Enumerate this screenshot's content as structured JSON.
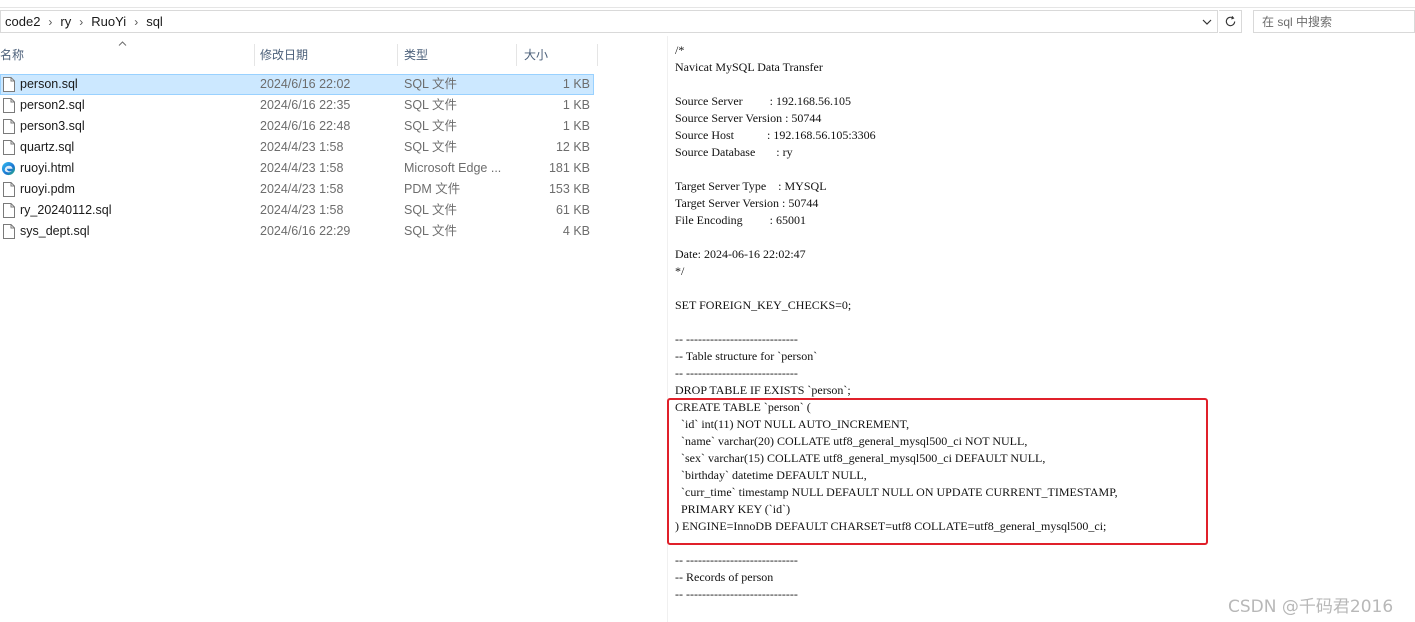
{
  "address_bar": {
    "crumbs": [
      "code2",
      "ry",
      "RuoYi",
      "sql"
    ],
    "search_placeholder": "在 sql 中搜索"
  },
  "columns": {
    "name": "名称",
    "date": "修改日期",
    "type": "类型",
    "size": "大小"
  },
  "files": [
    {
      "name": "person.sql",
      "date": "2024/6/16 22:02",
      "type": "SQL 文件",
      "size": "1 KB",
      "icon": "document-icon",
      "selected": true
    },
    {
      "name": "person2.sql",
      "date": "2024/6/16 22:35",
      "type": "SQL 文件",
      "size": "1 KB",
      "icon": "document-icon"
    },
    {
      "name": "person3.sql",
      "date": "2024/6/16 22:48",
      "type": "SQL 文件",
      "size": "1 KB",
      "icon": "document-icon"
    },
    {
      "name": "quartz.sql",
      "date": "2024/4/23 1:58",
      "type": "SQL 文件",
      "size": "12 KB",
      "icon": "document-icon"
    },
    {
      "name": "ruoyi.html",
      "date": "2024/4/23 1:58",
      "type": "Microsoft Edge ...",
      "size": "181 KB",
      "icon": "edge-icon"
    },
    {
      "name": "ruoyi.pdm",
      "date": "2024/4/23 1:58",
      "type": "PDM 文件",
      "size": "153 KB",
      "icon": "document-icon"
    },
    {
      "name": "ry_20240112.sql",
      "date": "2024/4/23 1:58",
      "type": "SQL 文件",
      "size": "61 KB",
      "icon": "document-icon"
    },
    {
      "name": "sys_dept.sql",
      "date": "2024/6/16 22:29",
      "type": "SQL 文件",
      "size": "4 KB",
      "icon": "document-icon"
    }
  ],
  "preview_lines": [
    "/*",
    "Navicat MySQL Data Transfer",
    "",
    "Source Server         : 192.168.56.105",
    "Source Server Version : 50744",
    "Source Host           : 192.168.56.105:3306",
    "Source Database       : ry",
    "",
    "Target Server Type    : MYSQL",
    "Target Server Version : 50744",
    "File Encoding         : 65001",
    "",
    "Date: 2024-06-16 22:02:47",
    "*/",
    "",
    "SET FOREIGN_KEY_CHECKS=0;",
    "",
    "-- ----------------------------",
    "-- Table structure for `person`",
    "-- ----------------------------",
    "DROP TABLE IF EXISTS `person`;",
    "CREATE TABLE `person` (",
    "  `id` int(11) NOT NULL AUTO_INCREMENT,",
    "  `name` varchar(20) COLLATE utf8_general_mysql500_ci NOT NULL,",
    "  `sex` varchar(15) COLLATE utf8_general_mysql500_ci DEFAULT NULL,",
    "  `birthday` datetime DEFAULT NULL,",
    "  `curr_time` timestamp NULL DEFAULT NULL ON UPDATE CURRENT_TIMESTAMP,",
    "  PRIMARY KEY (`id`)",
    ") ENGINE=InnoDB DEFAULT CHARSET=utf8 COLLATE=utf8_general_mysql500_ci;",
    "",
    "-- ----------------------------",
    "-- Records of person",
    "-- ----------------------------"
  ],
  "highlight_color": "#e0202a",
  "selection_color": "#cce8ff",
  "watermark": "CSDN @千码君2016"
}
